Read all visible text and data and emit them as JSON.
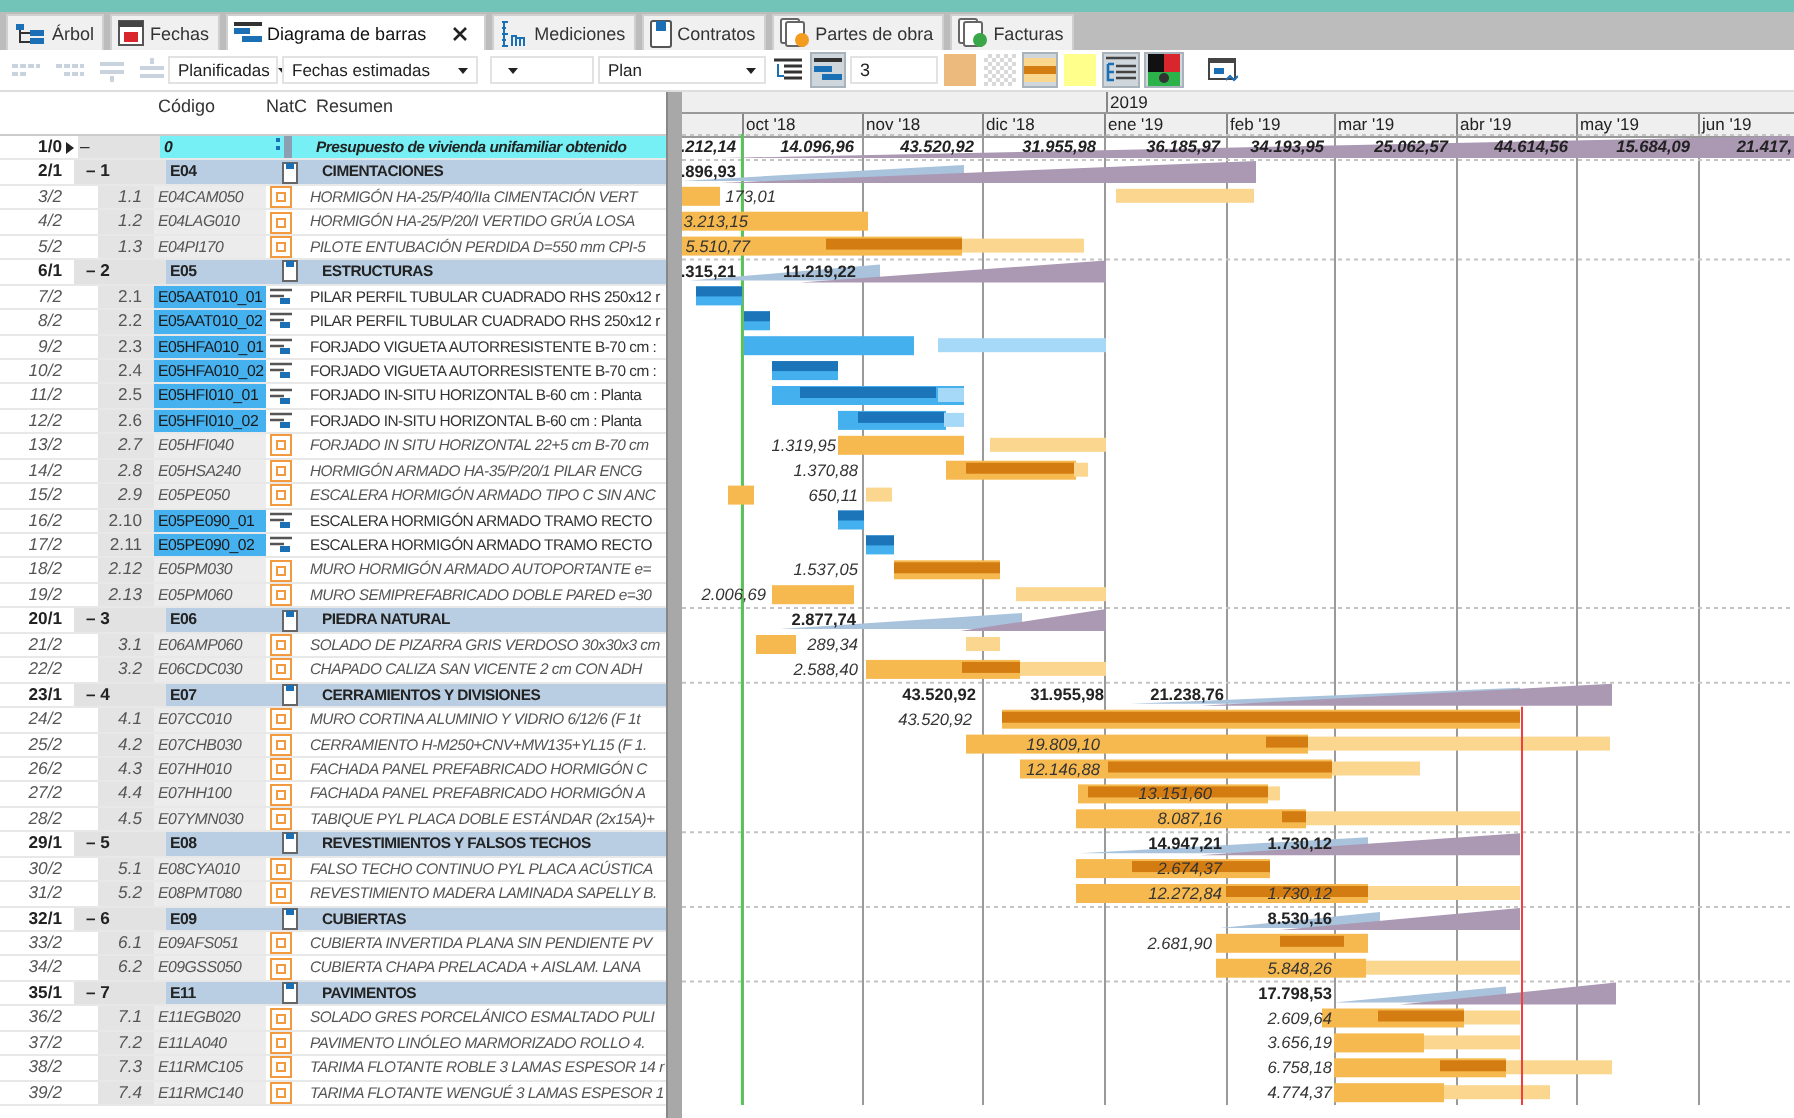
{
  "tabs": [
    {
      "label": "Árbol",
      "selected": false,
      "closable": false
    },
    {
      "label": "Fechas",
      "selected": false,
      "closable": false
    },
    {
      "label": "Diagrama de barras",
      "selected": true,
      "closable": true
    },
    {
      "label": "Mediciones",
      "selected": false,
      "closable": false
    },
    {
      "label": "Contratos",
      "selected": false,
      "closable": false
    },
    {
      "label": "Partes de obra",
      "selected": false,
      "closable": false
    },
    {
      "label": "Facturas",
      "selected": false,
      "closable": false
    }
  ],
  "toolbar": {
    "dropdowns": [
      {
        "value": "Planificadas"
      },
      {
        "value": "Fechas estimadas"
      },
      {
        "value": "Plan"
      }
    ],
    "view_buttons": [
      {
        "pressed": false
      },
      {
        "pressed": true
      }
    ],
    "level_field": "3",
    "style_buttons": [
      {
        "pressed": false
      },
      {
        "pressed": false
      },
      {
        "pressed": true
      },
      {
        "pressed": false
      }
    ],
    "tool_buttons": [
      {
        "pressed": true
      },
      {
        "pressed": true
      },
      {
        "pressed": false
      }
    ]
  },
  "columns": [
    "Código",
    "NatC",
    "Resumen"
  ],
  "timeline": {
    "year": "2019",
    "months": [
      "oct '18",
      "nov '18",
      "dic '18",
      "ene '19",
      "feb '19",
      "mar '19",
      "abr '19",
      "may '19",
      "jun '19"
    ]
  },
  "rows": [
    {
      "number": "1/0",
      "current": true,
      "outline": "–",
      "code": "0",
      "kind": "root",
      "summary": "Presupuesto de vivienda unifamiliar obtenido",
      "amounts": [
        ".212,14",
        "14.096,96",
        "43.520,92",
        "31.955,98",
        "36.185,97",
        "34.193,95",
        "25.062,57",
        "44.614,56",
        "15.684,09",
        "21.417,"
      ]
    },
    {
      "number": "2/1",
      "current": false,
      "outline": "– 1",
      "code": "E04",
      "kind": "chapter",
      "summary": "CIMENTACIONES",
      "amounts": [
        ".896,93"
      ]
    },
    {
      "number": "3/2",
      "current": false,
      "outline": "1.1",
      "code": "E04CAM050",
      "kind": "item",
      "summary": "HORMIGÓN HA-25/P/40/IIa CIMENTACIÓN VERT",
      "amounts": [
        "173,01"
      ]
    },
    {
      "number": "4/2",
      "current": false,
      "outline": "1.2",
      "code": "E04LAG010",
      "kind": "item",
      "summary": "HORMIGÓN HA-25/P/20/I VERTIDO GRÚA LOSA",
      "amounts": [
        "3.213,15"
      ]
    },
    {
      "number": "5/2",
      "current": false,
      "outline": "1.3",
      "code": "E04PI170",
      "kind": "item",
      "summary": "PILOTE ENTUBACIÓN PERDIDA D=550 mm CPI-5",
      "amounts": [
        "5.510,77"
      ]
    },
    {
      "number": "6/1",
      "current": false,
      "outline": "– 2",
      "code": "E05",
      "kind": "chapter",
      "summary": "ESTRUCTURAS",
      "amounts": [
        ".315,21",
        "11.219,22"
      ]
    },
    {
      "number": "7/2",
      "current": false,
      "outline": "2.1",
      "code": "E05AAT010_01",
      "kind": "task",
      "summary": "PILAR PERFIL TUBULAR CUADRADO RHS 250x12 r",
      "amounts": []
    },
    {
      "number": "8/2",
      "current": false,
      "outline": "2.2",
      "code": "E05AAT010_02",
      "kind": "task",
      "summary": "PILAR PERFIL TUBULAR CUADRADO RHS 250x12 r",
      "amounts": []
    },
    {
      "number": "9/2",
      "current": false,
      "outline": "2.3",
      "code": "E05HFA010_01",
      "kind": "task",
      "summary": "FORJADO VIGUETA AUTORRESISTENTE B-70 cm :",
      "amounts": []
    },
    {
      "number": "10/2",
      "current": false,
      "outline": "2.4",
      "code": "E05HFA010_02",
      "kind": "task",
      "summary": "FORJADO VIGUETA AUTORRESISTENTE B-70 cm :",
      "amounts": []
    },
    {
      "number": "11/2",
      "current": false,
      "outline": "2.5",
      "code": "E05HFI010_01",
      "kind": "task",
      "summary": "FORJADO IN-SITU HORIZONTAL B-60 cm : Planta",
      "amounts": []
    },
    {
      "number": "12/2",
      "current": false,
      "outline": "2.6",
      "code": "E05HFI010_02",
      "kind": "task",
      "summary": "FORJADO IN-SITU HORIZONTAL B-60 cm : Planta",
      "amounts": []
    },
    {
      "number": "13/2",
      "current": false,
      "outline": "2.7",
      "code": "E05HFI040",
      "kind": "item",
      "summary": "FORJADO IN SITU HORIZONTAL 22+5 cm B-70 cm",
      "amounts": [
        "1.319,95"
      ]
    },
    {
      "number": "14/2",
      "current": false,
      "outline": "2.8",
      "code": "E05HSA240",
      "kind": "item",
      "summary": "HORMIGÓN ARMADO HA-35/P/20/1 PILAR ENCG",
      "amounts": [
        "1.370,88"
      ]
    },
    {
      "number": "15/2",
      "current": false,
      "outline": "2.9",
      "code": "E05PE050",
      "kind": "item",
      "summary": "ESCALERA HORMIGÓN ARMADO TIPO C SIN ANC",
      "amounts": [
        "650,11"
      ]
    },
    {
      "number": "16/2",
      "current": false,
      "outline": "2.10",
      "code": "E05PE090_01",
      "kind": "task",
      "summary": "ESCALERA HORMIGÓN ARMADO TRAMO RECTO",
      "amounts": []
    },
    {
      "number": "17/2",
      "current": false,
      "outline": "2.11",
      "code": "E05PE090_02",
      "kind": "task",
      "summary": "ESCALERA HORMIGÓN ARMADO TRAMO RECTO",
      "amounts": []
    },
    {
      "number": "18/2",
      "current": false,
      "outline": "2.12",
      "code": "E05PM030",
      "kind": "item",
      "summary": "MURO HORMIGÓN ARMADO AUTOPORTANTE e=",
      "amounts": [
        "1.537,05"
      ]
    },
    {
      "number": "19/2",
      "current": false,
      "outline": "2.13",
      "code": "E05PM060",
      "kind": "item",
      "summary": "MURO SEMIPREFABRICADO DOBLE PARED e=30",
      "amounts": [
        "2.006,69"
      ]
    },
    {
      "number": "20/1",
      "current": false,
      "outline": "– 3",
      "code": "E06",
      "kind": "chapter",
      "summary": "PIEDRA NATURAL",
      "amounts": [
        "2.877,74"
      ]
    },
    {
      "number": "21/2",
      "current": false,
      "outline": "3.1",
      "code": "E06AMP060",
      "kind": "item",
      "summary": "SOLADO DE PIZARRA GRIS VERDOSO 30x30x3 cm",
      "amounts": [
        "289,34"
      ]
    },
    {
      "number": "22/2",
      "current": false,
      "outline": "3.2",
      "code": "E06CDC030",
      "kind": "item",
      "summary": "CHAPADO CALIZA SAN VICENTE 2 cm CON ADH",
      "amounts": [
        "2.588,40"
      ]
    },
    {
      "number": "23/1",
      "current": false,
      "outline": "– 4",
      "code": "E07",
      "kind": "chapter",
      "summary": "CERRAMIENTOS Y DIVISIONES",
      "amounts": [
        "43.520,92",
        "31.955,98",
        "21.238,76"
      ]
    },
    {
      "number": "24/2",
      "current": false,
      "outline": "4.1",
      "code": "E07CC010",
      "kind": "item",
      "summary": "MURO CORTINA ALUMINIO Y VIDRIO 6/12/6 (F 1t",
      "amounts": [
        "43.520,92"
      ]
    },
    {
      "number": "25/2",
      "current": false,
      "outline": "4.2",
      "code": "E07CHB030",
      "kind": "item",
      "summary": "CERRAMIENTO H-M250+CNV+MW135+YL15 (F 1.",
      "amounts": [
        "19.809,10"
      ]
    },
    {
      "number": "26/2",
      "current": false,
      "outline": "4.3",
      "code": "E07HH010",
      "kind": "item",
      "summary": "FACHADA PANEL PREFABRICADO HORMIGÓN C",
      "amounts": [
        "12.146,88"
      ]
    },
    {
      "number": "27/2",
      "current": false,
      "outline": "4.4",
      "code": "E07HH100",
      "kind": "item",
      "summary": "FACHADA PANEL PREFABRICADO HORMIGÓN A",
      "amounts": [
        "13.151,60"
      ]
    },
    {
      "number": "28/2",
      "current": false,
      "outline": "4.5",
      "code": "E07YMN030",
      "kind": "item",
      "summary": "TABIQUE PYL PLACA DOBLE ESTÁNDAR (2x15A)+",
      "amounts": [
        "8.087,16"
      ]
    },
    {
      "number": "29/1",
      "current": false,
      "outline": "– 5",
      "code": "E08",
      "kind": "chapter",
      "summary": "REVESTIMIENTOS Y FALSOS TECHOS",
      "amounts": [
        "14.947,21",
        "1.730,12"
      ]
    },
    {
      "number": "30/2",
      "current": false,
      "outline": "5.1",
      "code": "E08CYA010",
      "kind": "item",
      "summary": "FALSO TECHO CONTINUO PYL PLACA ACÚSTICA",
      "amounts": [
        "2.674,37"
      ]
    },
    {
      "number": "31/2",
      "current": false,
      "outline": "5.2",
      "code": "E08PMT080",
      "kind": "item",
      "summary": "REVESTIMIENTO MADERA LAMINADA SAPELLY B.",
      "amounts": [
        "12.272,84",
        "1.730,12"
      ]
    },
    {
      "number": "32/1",
      "current": false,
      "outline": "– 6",
      "code": "E09",
      "kind": "chapter",
      "summary": "CUBIERTAS",
      "amounts": [
        "8.530,16"
      ]
    },
    {
      "number": "33/2",
      "current": false,
      "outline": "6.1",
      "code": "E09AFS051",
      "kind": "item",
      "summary": "CUBIERTA INVERTIDA PLANA SIN PENDIENTE PV",
      "amounts": [
        "2.681,90"
      ]
    },
    {
      "number": "34/2",
      "current": false,
      "outline": "6.2",
      "code": "E09GSS050",
      "kind": "item",
      "summary": "CUBIERTA CHAPA PRELACADA + AISLAM. LANA",
      "amounts": [
        "5.848,26"
      ]
    },
    {
      "number": "35/1",
      "current": false,
      "outline": "– 7",
      "code": "E11",
      "kind": "chapter",
      "summary": "PAVIMENTOS",
      "amounts": [
        "17.798,53"
      ]
    },
    {
      "number": "36/2",
      "current": false,
      "outline": "7.1",
      "code": "E11EGB020",
      "kind": "item",
      "summary": "SOLADO GRES PORCELÁNICO ESMALTADO PULI",
      "amounts": [
        "2.609,64"
      ]
    },
    {
      "number": "37/2",
      "current": false,
      "outline": "7.2",
      "code": "E11LA040",
      "kind": "item",
      "summary": "PAVIMENTO LINÓLEO MARMORIZADO ROLLO 4.",
      "amounts": [
        "3.656,19"
      ]
    },
    {
      "number": "38/2",
      "current": false,
      "outline": "7.3",
      "code": "E11RMC105",
      "kind": "item",
      "summary": "TARIMA FLOTANTE ROBLE 3 LAMAS ESPESOR 14 r",
      "amounts": [
        "6.758,18"
      ]
    },
    {
      "number": "39/2",
      "current": false,
      "outline": "7.4",
      "code": "E11RMC140",
      "kind": "item",
      "summary": "TARIMA FLOTANTE WENGUÉ 3 LAMAS ESPESOR 1",
      "amounts": [
        "4.774,37"
      ]
    }
  ]
}
